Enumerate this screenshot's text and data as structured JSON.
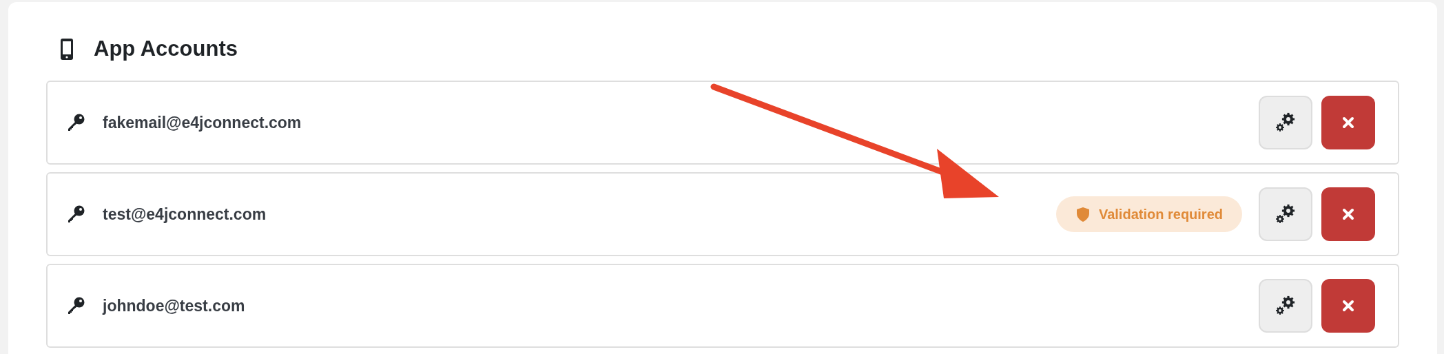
{
  "title": "App Accounts",
  "accounts": [
    {
      "email": "fakemail@e4jconnect.com"
    },
    {
      "email": "test@e4jconnect.com",
      "badge": {
        "label": "Validation required"
      }
    },
    {
      "email": "johndoe@test.com"
    }
  ]
}
